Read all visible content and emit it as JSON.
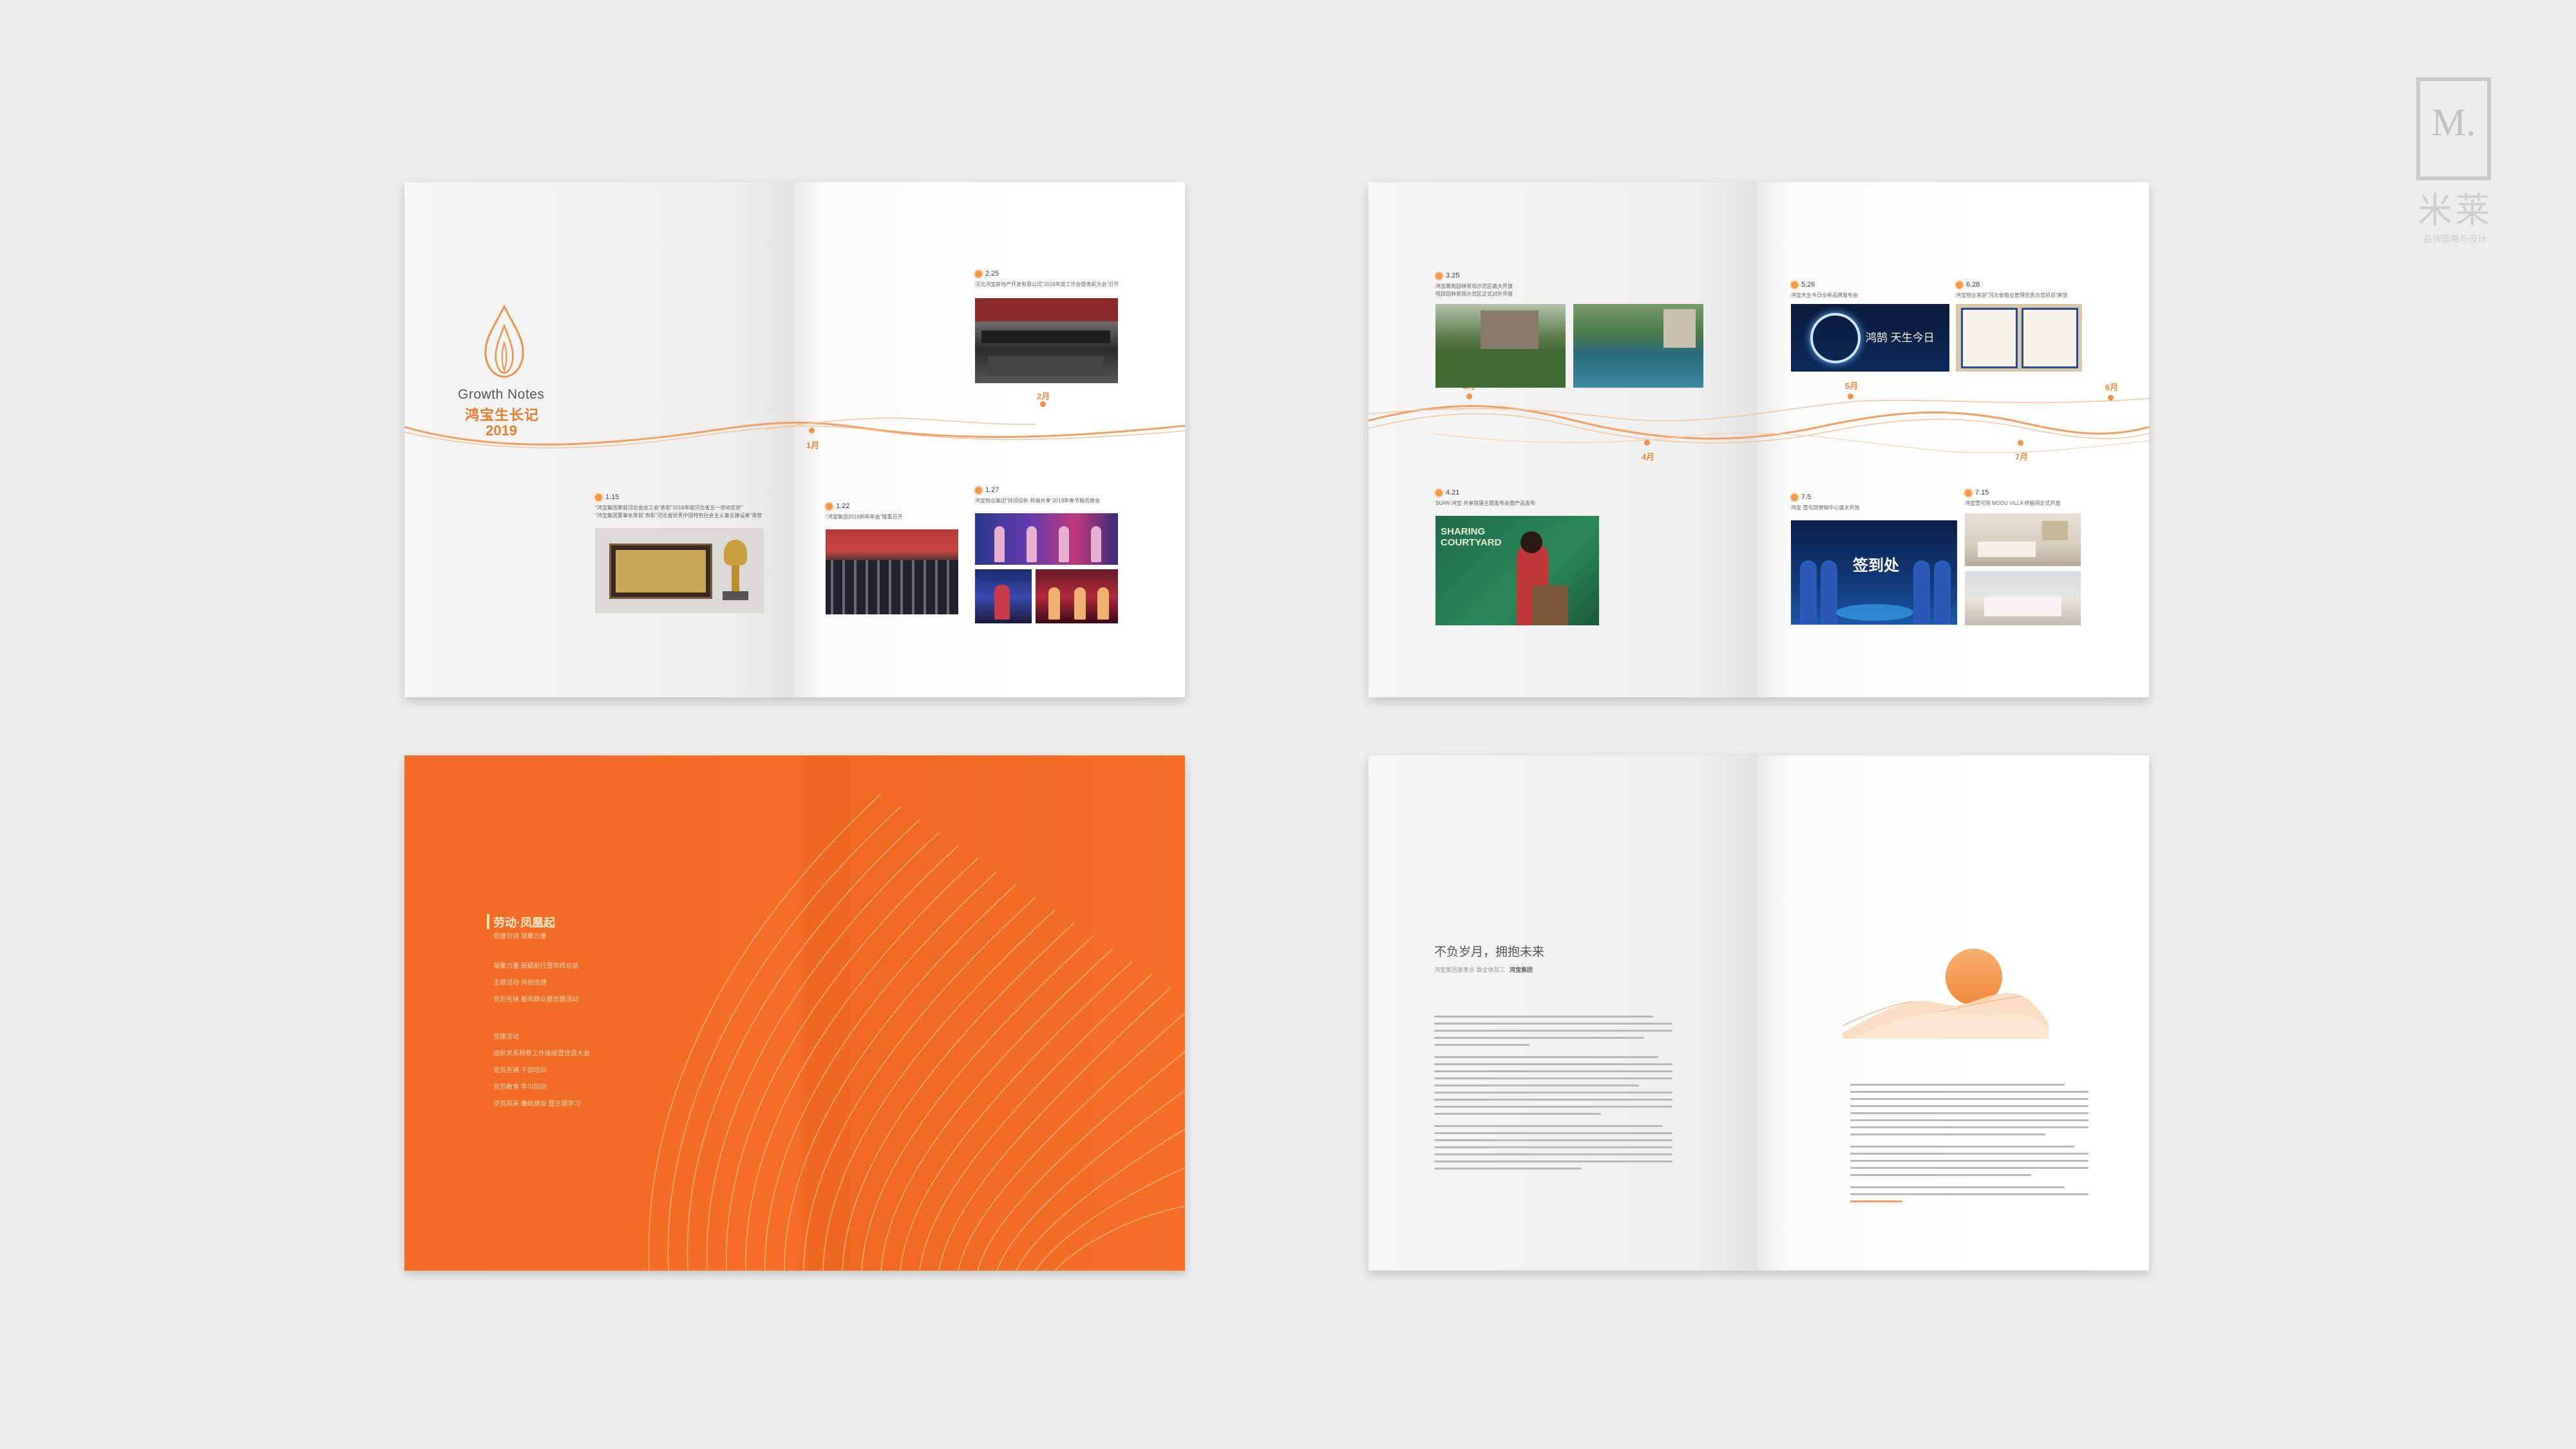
{
  "watermark": {
    "logo": "M.",
    "brand": "米莱",
    "tagline": "品牌策略与设计"
  },
  "colors": {
    "accent": "#f07a2c",
    "cover_orange": "#f26a22",
    "background": "#ededee"
  },
  "spread1": {
    "title_en": "Growth Notes",
    "title_cn": "鸿宝生长记",
    "year": "2019",
    "months": [
      "1月",
      "2月"
    ],
    "events": [
      {
        "date": "2.25",
        "text": "河北鸿宝房地产开发有限公司\"2019年度工作会暨表彰大会\"召开"
      },
      {
        "date": "1.15",
        "lines": [
          "\"鸿宝集团荣获河北省总工会\"表彰\"2018年度河北省五一劳动奖状\"",
          "\"鸿宝集团董事长荣获\"表彰\"河北省优秀中国特色社会主义事业建设者\"荣誉"
        ]
      },
      {
        "date": "1.22",
        "text": "\"鸿宝集团2019新年年会\"隆重召开"
      },
      {
        "date": "1.27",
        "text": "鸿宝物业集团\"辞旧迎新·和谐共享\"2019年春节联欢晚会"
      }
    ]
  },
  "spread2": {
    "months": [
      "3月",
      "4月",
      "5月",
      "6月",
      "7月"
    ],
    "events": [
      {
        "date": "3.25",
        "lines": [
          "鸿宝雅苑园林景观示范区盛大开放",
          "项目园林景观示范区正式对外开放"
        ]
      },
      {
        "date": "4.21",
        "text": "SUAN 鸿宝·共享院落主题发布会暨产品发布"
      },
      {
        "date": "5.26",
        "text": "鸿宝天生今日全新品牌发布会"
      },
      {
        "date": "6.28",
        "text": "鸿宝物业荣获\"河北省物业管理优秀示范项目\"荣誉"
      },
      {
        "date": "7.5",
        "text": "鸿宝·壹号院营销中心盛大开放"
      },
      {
        "date": "7.15",
        "text": "鸿宝壹号院 MODU VILLA 样板间正式开放"
      }
    ],
    "photo_text": {
      "ring": "鸿鹄 天生今日",
      "sharing": "SHARING COURTYARD",
      "signin": "签到处"
    }
  },
  "spread3": {
    "heading": "劳动·凤凰起",
    "sub": "党建引领 凝聚力量",
    "toc": [
      "凝聚力量 砥砺前行暨年终总结",
      "主题活动 共创佳绩",
      "党员先锋 服务群众暨志愿活动",
      "党建活动",
      "组织关系转移工作接续暨党员大会",
      "党员先锋 干部培训",
      "党员教育 学习培训",
      "党员风采 廉政建设 暨主题学习"
    ]
  },
  "spread4": {
    "article_title": "不负岁月，拥抱未来",
    "byline": "鸿宝集团董事长 致全体员工",
    "byline_name": "鸿宝集团"
  }
}
